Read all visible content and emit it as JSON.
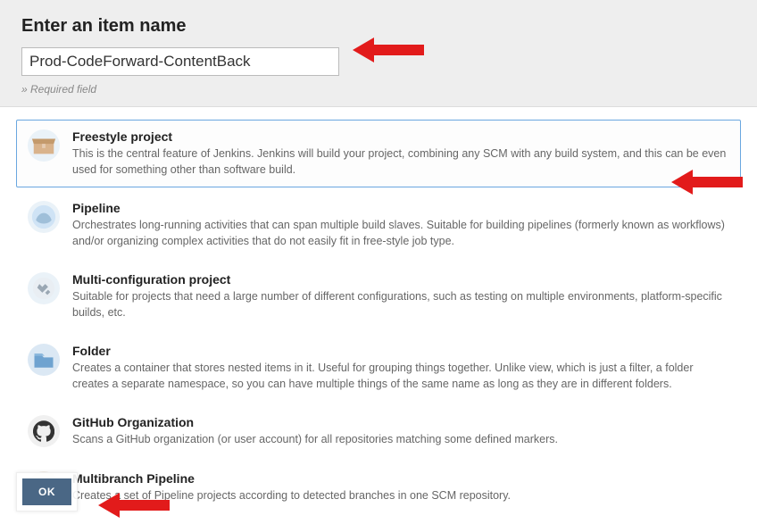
{
  "header": {
    "title": "Enter an item name",
    "name_value": "Prod-CodeForward-ContentBack",
    "required_text": "» Required field"
  },
  "options": [
    {
      "id": "freestyle",
      "title": "Freestyle project",
      "desc": "This is the central feature of Jenkins. Jenkins will build your project, combining any SCM with any build system, and this can be even used for something other than software build.",
      "icon": "box-icon",
      "selected": true
    },
    {
      "id": "pipeline",
      "title": "Pipeline",
      "desc": "Orchestrates long-running activities that can span multiple build slaves. Suitable for building pipelines (formerly known as workflows) and/or organizing complex activities that do not easily fit in free-style job type.",
      "icon": "pipeline-icon",
      "selected": false
    },
    {
      "id": "multiconfig",
      "title": "Multi-configuration project",
      "desc": "Suitable for projects that need a large number of different configurations, such as testing on multiple environments, platform-specific builds, etc.",
      "icon": "wrench-icon",
      "selected": false
    },
    {
      "id": "folder",
      "title": "Folder",
      "desc": "Creates a container that stores nested items in it. Useful for grouping things together. Unlike view, which is just a filter, a folder creates a separate namespace, so you can have multiple things of the same name as long as they are in different folders.",
      "icon": "folder-icon",
      "selected": false
    },
    {
      "id": "githuborg",
      "title": "GitHub Organization",
      "desc": "Scans a GitHub organization (or user account) for all repositories matching some defined markers.",
      "icon": "github-icon",
      "selected": false
    },
    {
      "id": "multibranch",
      "title": "Multibranch Pipeline",
      "desc": "Creates a set of Pipeline projects according to detected branches in one SCM repository.",
      "icon": "branch-icon",
      "selected": false
    }
  ],
  "footer": {
    "ok_label": "OK"
  },
  "annotations": {
    "arrow_color": "#e21b1b"
  }
}
